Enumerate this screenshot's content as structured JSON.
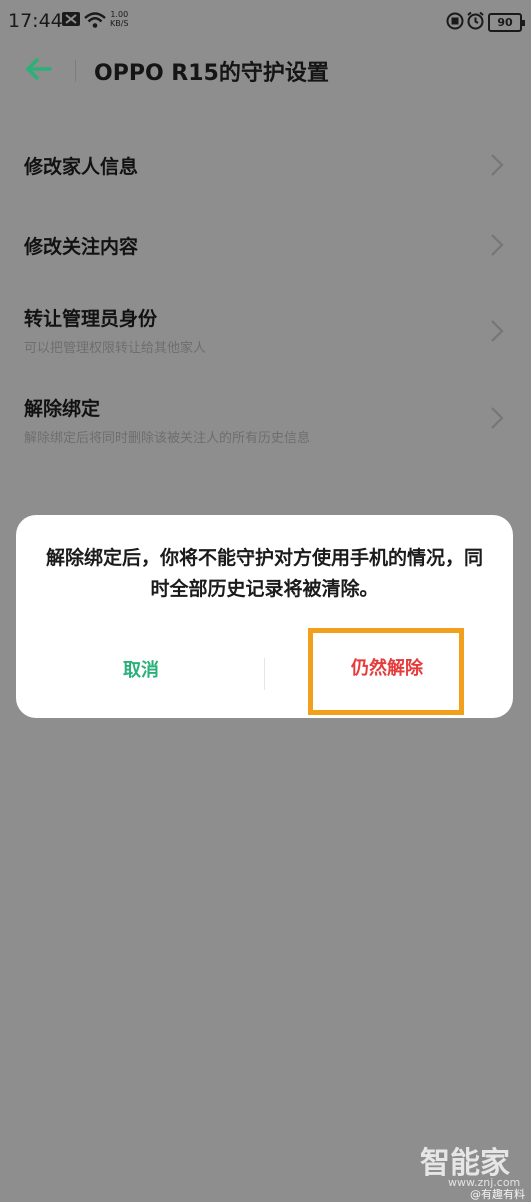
{
  "status_bar": {
    "time": "17:44",
    "net_speed_value": "1.00",
    "net_speed_unit": "KB/S",
    "battery": "90",
    "icons": [
      "message-icon",
      "wifi-icon",
      "nfc-icon",
      "alarm-icon",
      "battery-icon"
    ]
  },
  "header": {
    "back_icon": "arrow-left-icon",
    "title": "OPPO R15的守护设置"
  },
  "settings": {
    "items": [
      {
        "label": "修改家人信息",
        "subtitle": ""
      },
      {
        "label": "修改关注内容",
        "subtitle": ""
      },
      {
        "label": "转让管理员身份",
        "subtitle": "可以把管理权限转让给其他家人"
      },
      {
        "label": "解除绑定",
        "subtitle": "解除绑定后将同时删除该被关注人的所有历史信息"
      }
    ]
  },
  "dialog": {
    "message": "解除绑定后，你将不能守护对方使用手机的情况，同时全部历史记录将被清除。",
    "cancel_label": "取消",
    "confirm_label": "仍然解除"
  },
  "watermark": {
    "logo": "智能家",
    "url": "www.znj.com",
    "corner": "@有趣有料"
  },
  "colors": {
    "accent_green": "#2bb079",
    "confirm_red": "#e53b3b",
    "highlight_orange": "#f2a01c",
    "overlay_gray": "#8e8e8e"
  }
}
